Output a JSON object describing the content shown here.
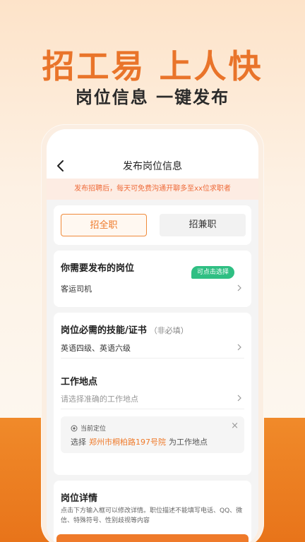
{
  "promo": {
    "headline": "招工易 上人快",
    "subline": "岗位信息 一键发布"
  },
  "nav": {
    "title": "发布岗位信息"
  },
  "notice": "发布招聘后，每天可免费沟通开聊多至xx位求职者",
  "job_type": {
    "full_time": "招全职",
    "part_time": "招兼职",
    "selected": "招全职"
  },
  "post": {
    "title": "你需要发布的岗位",
    "value": "客运司机"
  },
  "skills": {
    "title": "岗位必需的技能/证书",
    "optional": "（非必填）",
    "value": "英语四级、英语六级"
  },
  "workplace": {
    "title": "工作地点",
    "placeholder": "请选择准确的工作地点",
    "current_label": "当前定位",
    "select_prefix": "选择",
    "address": "郑州市桐柏路197号院",
    "select_suffix": "为工作地点",
    "tap_hint": "可点击选择"
  },
  "detail": {
    "title": "岗位详情",
    "description": "点击下方输入框可以修改详情。职位描述不能填写电话、QQ、微信、特殊符号、性别歧视等内容"
  },
  "colors": {
    "accent": "#ef7a2a",
    "notice_bg": "#fdece3",
    "tag_green": "#2fbf83"
  }
}
